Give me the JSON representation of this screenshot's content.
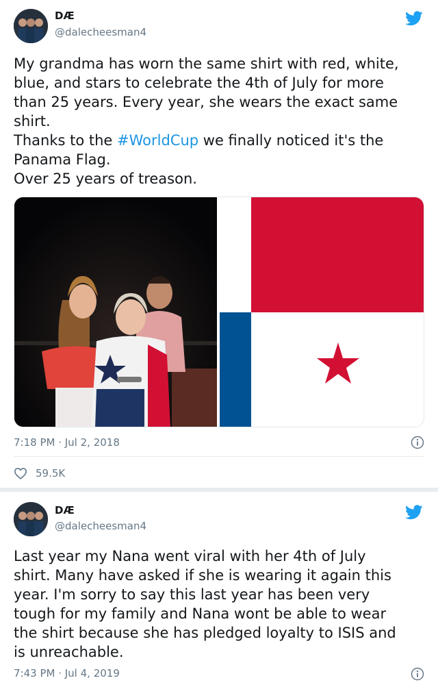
{
  "tweets": [
    {
      "author": {
        "name": "DÆ",
        "handle": "@dalecheesman4"
      },
      "text_lines": [
        "My grandma has worn the same shirt with red, white,",
        "blue, and stars to celebrate the 4th of July for more",
        "than 25 years. Every year, she wears the exact same",
        "shirt."
      ],
      "text_line5": {
        "before": "Thanks to the ",
        "hashtag": "#WorldCup",
        "after": " we finally noticed it's the"
      },
      "text_tail": [
        "Panama Flag.",
        "Over 25 years of treason."
      ],
      "timestamp": "7:18 PM · Jul 2, 2018",
      "likes": "59.5K"
    },
    {
      "author": {
        "name": "DÆ",
        "handle": "@dalecheesman4"
      },
      "text_lines": [
        "Last year my Nana went viral with her 4th of July",
        "shirt. Many have asked if she is wearing it again this",
        "year. I'm sorry to say this last year has been very",
        "tough for my family and Nana wont be able to wear",
        "the shirt because she has pledged loyalty to ISIS and",
        "is unreachable."
      ],
      "timestamp": "7:43 PM · Jul 4, 2019"
    }
  ],
  "colors": {
    "twitter_blue": "#1da1f2",
    "hashtag": "#1b95e0",
    "secondary_text": "#657786",
    "flag_red": "#d21034",
    "flag_blue": "#005293"
  },
  "icons": {
    "brand": "twitter-bird-icon",
    "info": "info-icon",
    "like": "heart-icon"
  }
}
